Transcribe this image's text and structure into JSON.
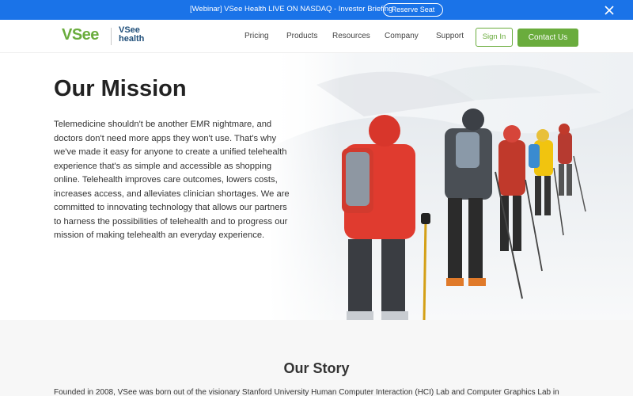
{
  "announcement": {
    "text": "[Webinar] VSee Health LIVE ON NASDAQ - Investor Briefing",
    "button": "Reserve Seat"
  },
  "logo": {
    "vsee": "VSee",
    "health_line1": "VSee",
    "health_line2": "health"
  },
  "nav": {
    "items": [
      "Pricing",
      "Products",
      "Resources",
      "Company",
      "Support"
    ],
    "signin": "Sign In",
    "contact": "Contact Us"
  },
  "hero": {
    "title": "Our Mission",
    "text": "Telemedicine shouldn't be another EMR nightmare, and doctors don't need more apps they won't use. That's why we've made it easy for anyone to create a unified telehealth experience that's as simple and accessible as shopping online. Telehealth improves care outcomes, lowers costs, increases access, and alleviates clinician shortages. We are committed to innovating technology that allows our partners to harness the possibilities of telehealth and to progress our mission of making telehealth an everyday experience."
  },
  "story": {
    "title": "Our Story",
    "text": "Founded in 2008, VSee was born out of the visionary Stanford University Human Computer Interaction (HCI) Lab and Computer Graphics Lab in"
  },
  "colors": {
    "brand_green": "#6aac3d",
    "banner_blue": "#1a73e8",
    "health_navy": "#1f4e79"
  },
  "icons": {
    "close": "close-icon",
    "hero_image": "skiers-photo"
  }
}
